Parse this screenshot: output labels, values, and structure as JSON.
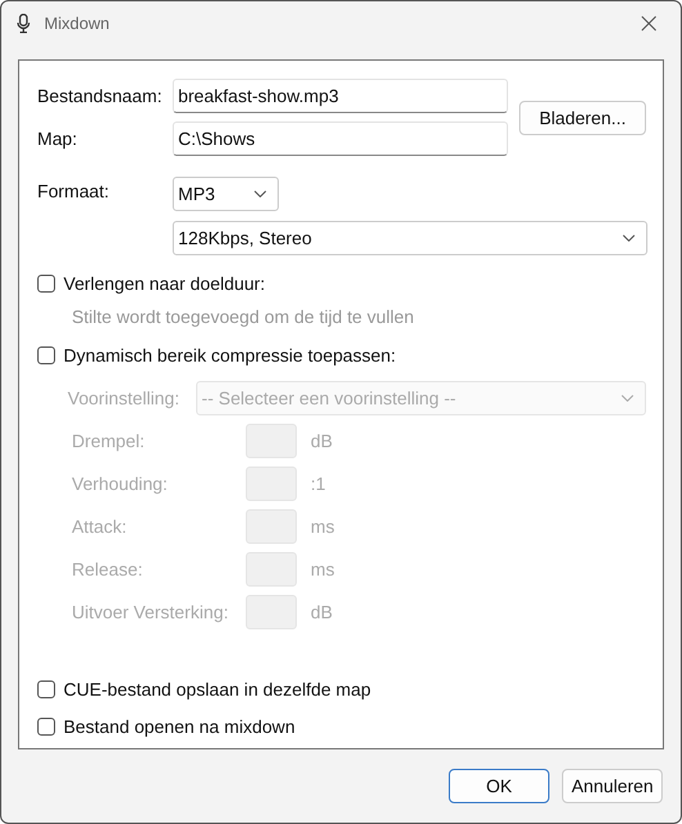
{
  "window": {
    "title": "Mixdown"
  },
  "file_name": {
    "label": "Bestandsnaam:",
    "value": "breakfast-show.mp3"
  },
  "folder": {
    "label": "Map:",
    "value": "C:\\Shows"
  },
  "browse_button": "Bladeren...",
  "format": {
    "label": "Formaat:",
    "value": "MP3",
    "quality": "128Kbps, Stereo"
  },
  "extend": {
    "label": "Verlengen naar doelduur:",
    "checked": false,
    "hint": "Stilte wordt toegevoegd om de tijd te vullen"
  },
  "compression": {
    "label": "Dynamisch bereik compressie toepassen:",
    "checked": false,
    "disabled": true,
    "preset": {
      "label": "Voorinstelling:",
      "value": "-- Selecteer een voorinstelling --"
    },
    "params": [
      {
        "label": "Drempel:",
        "unit": "dB"
      },
      {
        "label": "Verhouding:",
        "unit": ":1"
      },
      {
        "label": "Attack:",
        "unit": "ms"
      },
      {
        "label": "Release:",
        "unit": "ms"
      },
      {
        "label": "Uitvoer Versterking:",
        "unit": "dB"
      }
    ]
  },
  "options": [
    {
      "label": "CUE-bestand opslaan in dezelfde map",
      "checked": false
    },
    {
      "label": "Bestand openen na mixdown",
      "checked": false
    }
  ],
  "buttons": [
    {
      "label": "OK",
      "kind": "primary"
    },
    {
      "label": "Annuleren",
      "kind": "secondary"
    }
  ]
}
